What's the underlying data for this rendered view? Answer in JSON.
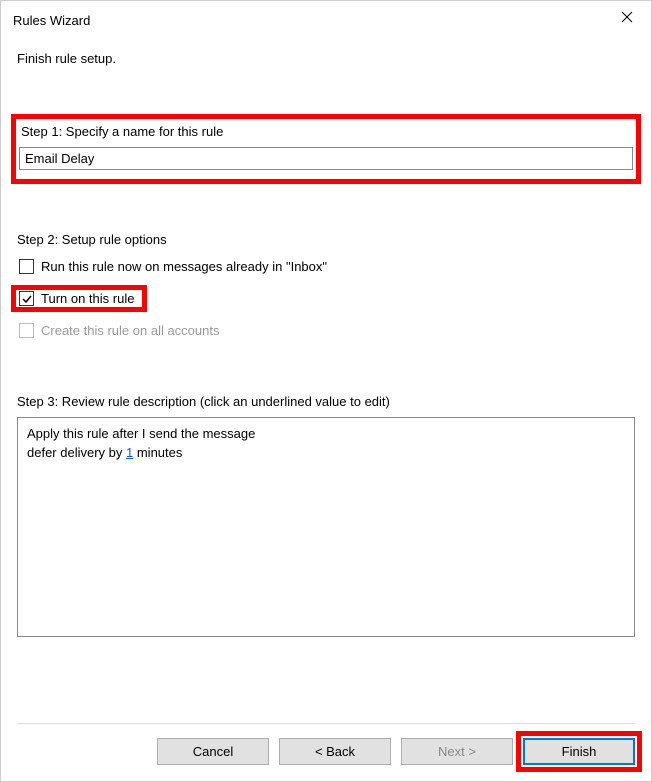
{
  "titlebar": {
    "title": "Rules Wizard"
  },
  "subtitle": "Finish rule setup.",
  "step1": {
    "label": "Step 1: Specify a name for this rule",
    "value": "Email Delay"
  },
  "step2": {
    "label": "Step 2: Setup rule options",
    "opt_run_now": "Run this rule now on messages already in \"Inbox\"",
    "opt_turn_on": "Turn on this rule",
    "opt_all_accounts": "Create this rule on all accounts"
  },
  "step3": {
    "label": "Step 3: Review rule description (click an underlined value to edit)",
    "line1": "Apply this rule after I send the message",
    "line2_a": "defer delivery by ",
    "line2_link": "1",
    "line2_b": " minutes"
  },
  "buttons": {
    "cancel": "Cancel",
    "back": "< Back",
    "next": "Next >",
    "finish": "Finish"
  }
}
